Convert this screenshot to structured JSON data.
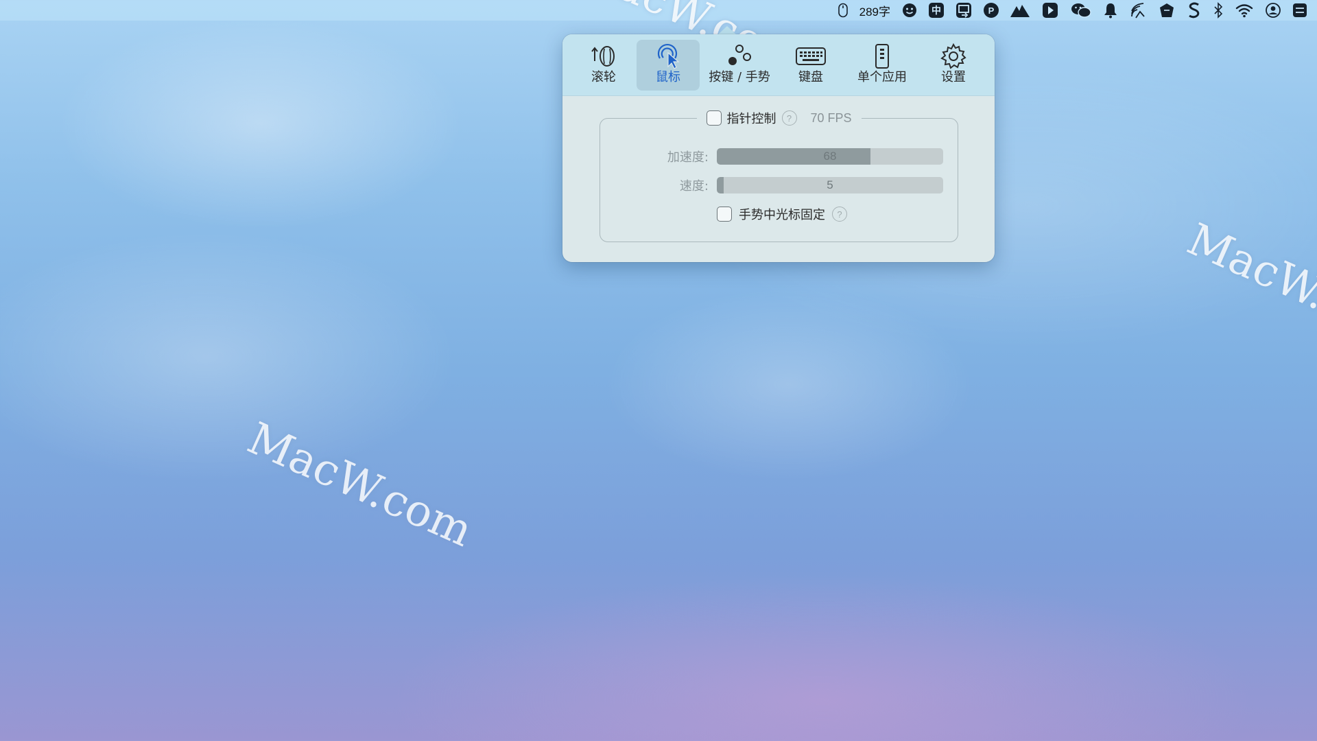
{
  "menubar": {
    "word_count": "289字",
    "input_method": "中",
    "p_badge": "P",
    "items": [
      {
        "icon": "mouse-icon"
      },
      {
        "icon": "smiley-icon"
      },
      {
        "icon": "input-method-icon"
      },
      {
        "icon": "screen-share-icon"
      },
      {
        "icon": "p-badge-icon"
      },
      {
        "icon": "mountain-icon"
      },
      {
        "icon": "play-badge-icon"
      },
      {
        "icon": "wechat-icon"
      },
      {
        "icon": "notification-bell-icon"
      },
      {
        "icon": "rss-wave-icon"
      },
      {
        "icon": "bag-icon"
      },
      {
        "icon": "s-logo-icon"
      },
      {
        "icon": "bluetooth-icon"
      },
      {
        "icon": "wifi-icon"
      },
      {
        "icon": "user-account-icon"
      },
      {
        "icon": "control-center-icon"
      }
    ]
  },
  "popover": {
    "tabs": [
      {
        "label": "滚轮",
        "icon": "scroll-wheel-icon",
        "selected": false
      },
      {
        "label": "鼠标",
        "icon": "mouse-pointer-icon",
        "selected": true
      },
      {
        "label": "按键 / 手势",
        "icon": "gesture-icon",
        "selected": false
      },
      {
        "label": "键盘",
        "icon": "keyboard-icon",
        "selected": false
      },
      {
        "label": "单个应用",
        "icon": "single-app-icon",
        "selected": false
      },
      {
        "label": "设置",
        "icon": "gear-icon",
        "selected": false
      }
    ],
    "pointer_control": {
      "label": "指针控制",
      "help": "?",
      "fps": "70 FPS",
      "checked": false
    },
    "acceleration": {
      "label": "加速度:",
      "value": "68",
      "fill_fraction": 0.68
    },
    "speed": {
      "label": "速度:",
      "value": "5",
      "fill_fraction": 0.03
    },
    "fixed_cursor": {
      "label": "手势中光标固定",
      "help": "?",
      "checked": false
    }
  },
  "watermark": {
    "text": "MacW.com"
  },
  "colors": {
    "accent": "#1f63c9",
    "popover_bg": "#dce8ea",
    "toolbar_bg": "#c2e3ef"
  }
}
